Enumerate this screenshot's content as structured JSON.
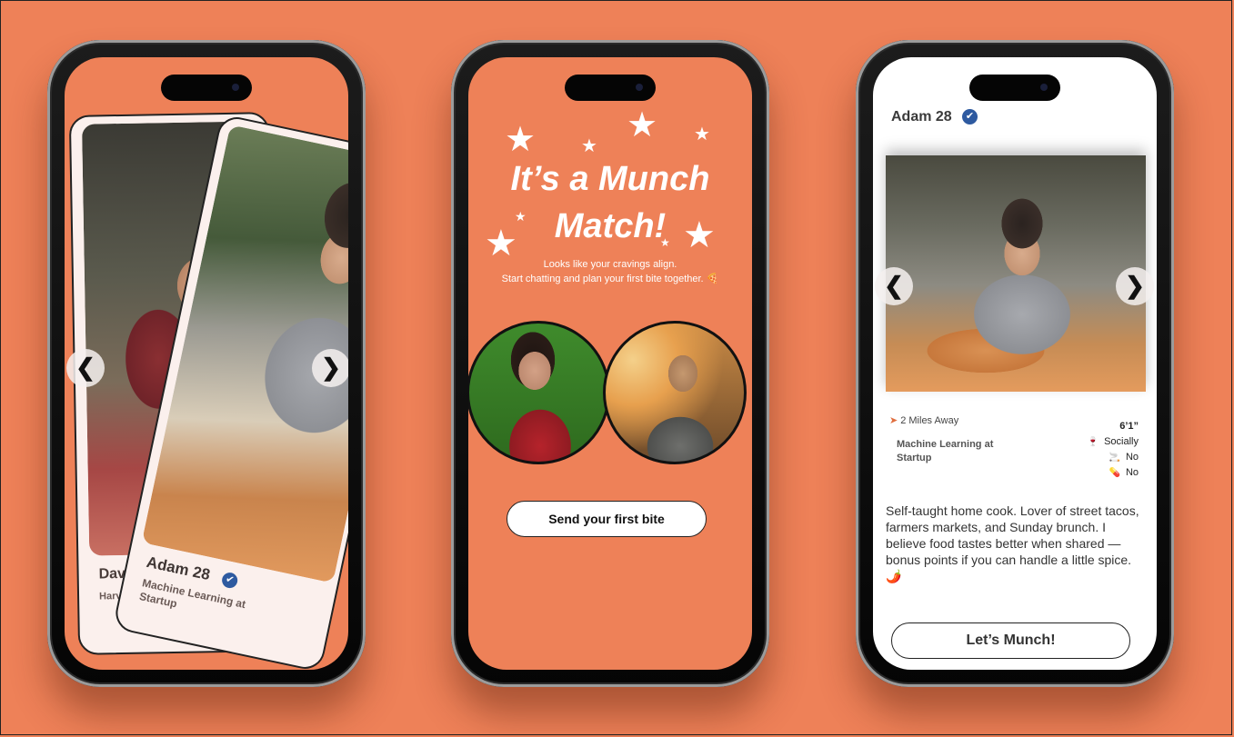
{
  "phone1": {
    "card_back": {
      "name": "David",
      "subtitle": "Harvard"
    },
    "card_front": {
      "name": "Adam 28",
      "verified_icon": "check-badge-icon",
      "subtitle": "Machine Learning at Startup"
    },
    "nav": {
      "prev_icon": "chevron-left-icon",
      "next_icon": "chevron-right-icon",
      "prev_symbol": "❮",
      "next_symbol": "❯"
    }
  },
  "phone2": {
    "title": "It’s a Munch Match!",
    "subtitle_line1": "Looks like your cravings align.",
    "subtitle_line2": "Start chatting and plan your first bite together. 🍕",
    "primary_button": "Send your first bite",
    "decoration_icon": "star-icon"
  },
  "phone3": {
    "name": "Adam 28",
    "verified_icon": "check-badge-icon",
    "distance": "2 Miles Away",
    "job": "Machine Learning at Startup",
    "height": "6’1”",
    "drinks": "Socially",
    "smokes": "No",
    "drugs": "No",
    "bio": "Self-taught home cook. Lover of street tacos, farmers markets, and Sunday brunch. I believe food tastes better when shared — bonus points if you can handle a little spice. 🌶️",
    "primary_button": "Let’s Munch!",
    "nav": {
      "prev_symbol": "❮",
      "next_symbol": "❯"
    }
  },
  "colors": {
    "background": "#ee8158",
    "verified": "#2e5aa0",
    "phone_body": "#111111"
  }
}
